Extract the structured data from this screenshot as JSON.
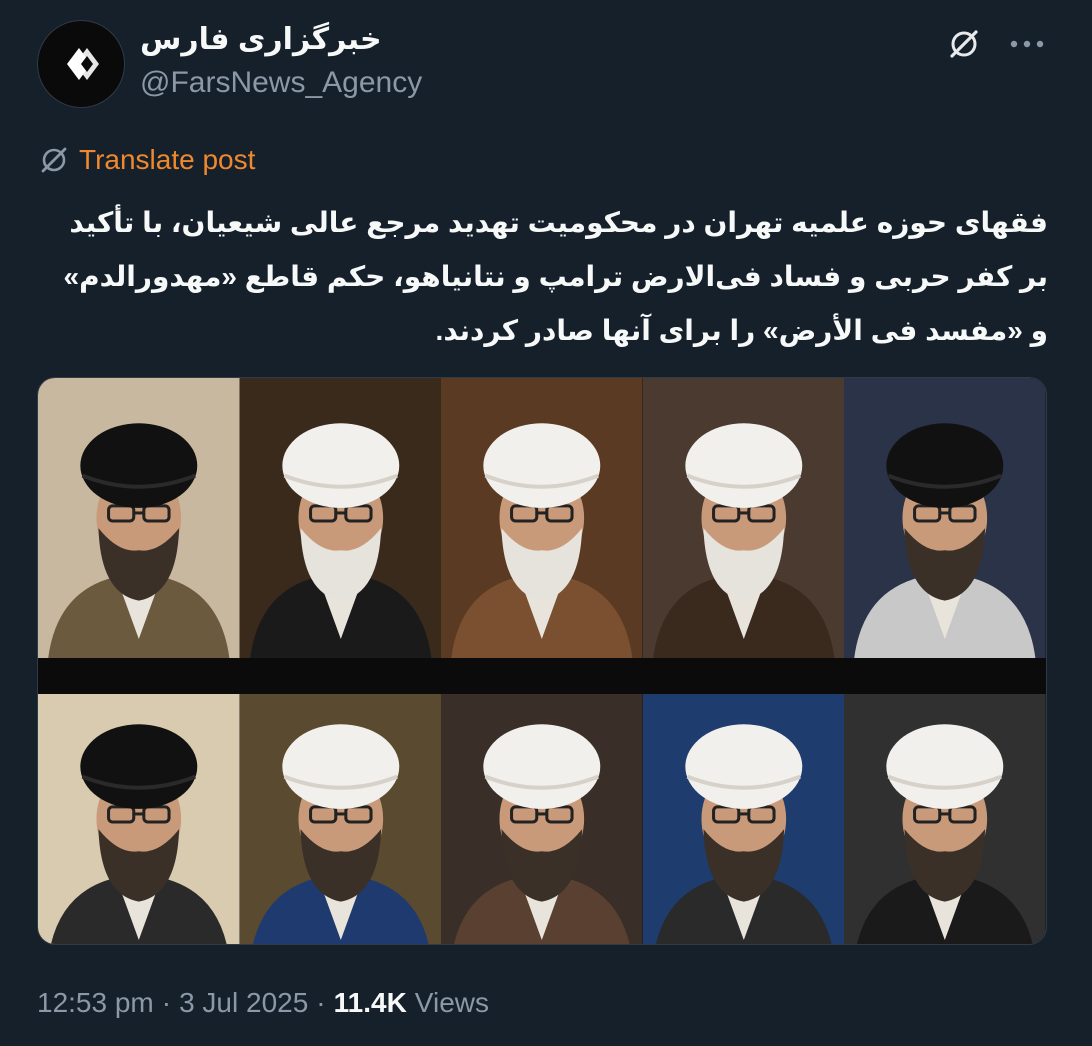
{
  "author": {
    "display_name": "خبرگزاری فارس",
    "handle": "@FarsNews_Agency",
    "avatar_icon": "diamond-logo-icon"
  },
  "actions": {
    "grok_icon": "grok-icon",
    "more_icon": "more-dots-icon"
  },
  "translate": {
    "label": "Translate post",
    "icon": "grok-translate-icon"
  },
  "post": {
    "text": "فقهای حوزه علمیه تهران در محکومیت تهدید مرجع عالی شیعیان، با تأکید بر کفر حربی و فساد فی‌الارض ترامپ و نتانیاهو، حکم قاطع «مهدورالدم» و «مفسد فی الأرض» را برای آنها صادر کردند."
  },
  "media": {
    "portraits": [
      {
        "headwear": "black",
        "bg": "#c9b8a0",
        "robe": "#6b5a3e"
      },
      {
        "headwear": "white",
        "bg": "#3a2a1c",
        "robe": "#1a1a1a"
      },
      {
        "headwear": "white",
        "bg": "#5a3a22",
        "robe": "#7a5030"
      },
      {
        "headwear": "white",
        "bg": "#4a3a30",
        "robe": "#3a2a1e"
      },
      {
        "headwear": "black",
        "bg": "#2a3348",
        "robe": "#c8c8c8"
      },
      {
        "headwear": "black",
        "bg": "#d8cbb0",
        "robe": "#2a2a2a"
      },
      {
        "headwear": "white",
        "bg": "#5a4a30",
        "robe": "#1f3a6e"
      },
      {
        "headwear": "white",
        "bg": "#3a2e28",
        "robe": "#5a4030"
      },
      {
        "headwear": "white",
        "bg": "#1e3c6e",
        "robe": "#2a2a2a"
      },
      {
        "headwear": "white",
        "bg": "#303030",
        "robe": "#1a1a1a"
      }
    ]
  },
  "meta": {
    "time": "12:53 pm",
    "date": "3 Jul 2025",
    "views_count": "11.4K",
    "views_label": "Views",
    "separator": "·"
  }
}
